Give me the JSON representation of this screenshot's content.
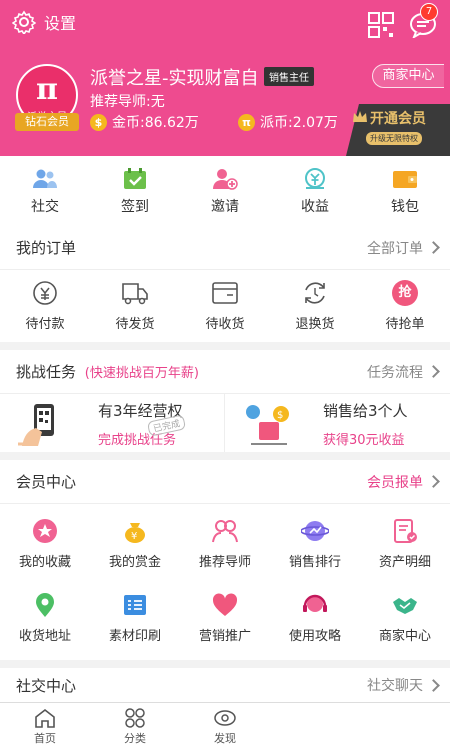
{
  "header": {
    "settings_label": "设置",
    "message_badge": "7",
    "avatar_caption": "派誉之星",
    "member_level": "钻石会员",
    "user_name": "派誉之星-实现财富自",
    "user_title": "销售主任",
    "mentor": "推荐导师:无",
    "gold_coin": "金币:86.62万",
    "pai_coin": "派币:2.07万",
    "merchant_center": "商家中心",
    "vip_open": "开通会员",
    "vip_sub": "升级无限特权"
  },
  "quick": [
    {
      "label": "社交",
      "icon": "social-icon"
    },
    {
      "label": "签到",
      "icon": "checkin-icon"
    },
    {
      "label": "邀请",
      "icon": "invite-icon"
    },
    {
      "label": "收益",
      "icon": "earnings-icon"
    },
    {
      "label": "钱包",
      "icon": "wallet-icon"
    }
  ],
  "orders": {
    "title": "我的订单",
    "all_label": "全部订单",
    "items": [
      {
        "label": "待付款",
        "icon": "pending-payment-icon"
      },
      {
        "label": "待发货",
        "icon": "pending-shipment-icon"
      },
      {
        "label": "待收货",
        "icon": "pending-receipt-icon"
      },
      {
        "label": "退换货",
        "icon": "return-icon"
      },
      {
        "label": "待抢单",
        "icon": "grab-order-icon"
      }
    ]
  },
  "challenge": {
    "title": "挑战任务",
    "subtitle": "(快速挑战百万年薪)",
    "flow_label": "任务流程",
    "stamp": "已完成",
    "task1": {
      "title": "有3年经营权",
      "action": "完成挑战任务"
    },
    "task2": {
      "title": "销售给3个人",
      "action": "获得30元收益"
    }
  },
  "member": {
    "title": "会员中心",
    "report_label": "会员报单",
    "items": [
      {
        "label": "我的收藏",
        "icon": "favorite-icon"
      },
      {
        "label": "我的赏金",
        "icon": "bounty-icon"
      },
      {
        "label": "推荐导师",
        "icon": "mentor-icon"
      },
      {
        "label": "销售排行",
        "icon": "ranking-icon"
      },
      {
        "label": "资产明细",
        "icon": "assets-icon"
      },
      {
        "label": "收货地址",
        "icon": "address-icon"
      },
      {
        "label": "素材印刷",
        "icon": "print-icon"
      },
      {
        "label": "营销推广",
        "icon": "promotion-icon"
      },
      {
        "label": "使用攻略",
        "icon": "guide-icon"
      },
      {
        "label": "商家中心",
        "icon": "merchant-icon"
      }
    ]
  },
  "social": {
    "title": "社交中心",
    "chat_label": "社交聊天"
  },
  "nav": [
    {
      "label": "首页",
      "icon": "home-icon"
    },
    {
      "label": "分类",
      "icon": "category-icon"
    },
    {
      "label": "发现",
      "icon": "discover-icon"
    }
  ],
  "colors": {
    "brand": "#ee4b8f",
    "accent": "#e8428a",
    "gold": "#f5b81f"
  }
}
